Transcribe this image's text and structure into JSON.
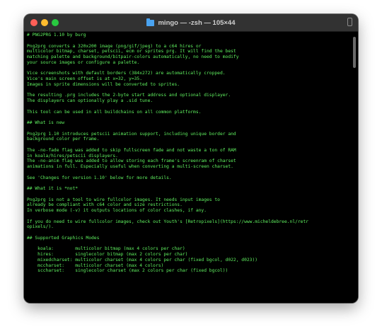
{
  "window": {
    "title": "mingo — -zsh — 105×44",
    "title_icon": "folder-icon",
    "controls": [
      "close",
      "minimize",
      "zoom"
    ]
  },
  "terminal": {
    "text_color": "#5ff05f",
    "background": "#000000",
    "lines": [
      "# PNG2PRG 1.10 by burg",
      "",
      "Png2prg converts a 320x200 image (png/gif/jpeg) to a c64 hires or",
      "multicolor bitmap, charset, petscii, ecm or sprites prg. It will find the best",
      "matching palette and background/bitpair-colors automatically, no need to modify",
      "your source images or configure a palette.",
      "",
      "Vice screenshots with default borders (384x272) are automatically cropped.",
      "Vice's main screen offset is at x=32, y=35.",
      "Images in sprite dimensions will be converted to sprites.",
      "",
      "The resulting .prg includes the 2-byte start address and optional displayer.",
      "The displayers can optionally play a .sid tune.",
      "",
      "This tool can be used in all buildchains on all common platforms.",
      "",
      "## What is new",
      "",
      "Png2prg 1.10 introduces petscii animation support, including unique border and",
      "background color per frame.",
      "",
      "The -no-fade flag was added to skip fullscreen fade and not waste a ton of RAM",
      "in koala/hires/petscii displayers.",
      "The -no-anim flag was added to allow storing each frame's screenram of charset",
      "animations in full. Especially useful when converting a multi-screen charset.",
      "",
      "See 'Changes for version 1.10' below for more details.",
      "",
      "## What it is *not*",
      "",
      "Png2prg is not a tool to wire fullcolor images. It needs input images to",
      "already be compliant with c64 color and size restrictions.",
      "In verbose mode (-v) it outputs locations of color clashes, if any.",
      "",
      "If you do need to wire fullcolor images, check out Youth's [Retropixels](https://www.micheldebree.nl/retr",
      "opixels/).",
      "",
      "## Supported Graphics Modes",
      "",
      "    koala:        multicolor bitmap (max 4 colors per char)",
      "    hires:        singlecolor bitmap (max 2 colors per char)",
      "    mixedcharset: multicolor charset (max 4 colors per char (fixed bgcol, d022, d023))",
      "    mccharset:    multicolor charset (max 4 colors)",
      "    sccharset:    singlecolor charset (max 2 colors per char (fixed bgcol))"
    ]
  }
}
